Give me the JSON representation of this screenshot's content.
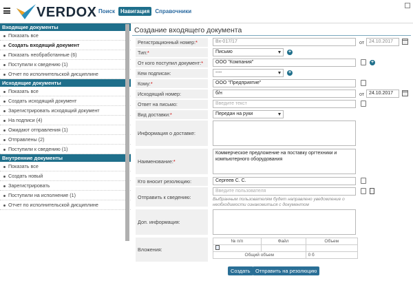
{
  "header": {
    "brand": "VERDOX",
    "nav": [
      "Поиск",
      "Навигация",
      "Справочники"
    ]
  },
  "sidebar": {
    "sections": [
      {
        "title": "Входящие документы",
        "items": [
          "Показать все",
          "Создать входящий документ",
          "Показать необработанные (6)",
          "Поступили к сведению (1)",
          "Отчет по исполнительской дисциплине"
        ]
      },
      {
        "title": "Исходящие документы",
        "items": [
          "Показать все",
          "Создать исходящий документ",
          "Зарегистрировать исходящий документ",
          "На подписи (4)",
          "Ожидают отправления (1)",
          "Отправлены (2)",
          "Поступили к сведению (1)"
        ]
      },
      {
        "title": "Внутренние документы",
        "items": [
          "Показать все",
          "Создать новый",
          "Зарегистрировать",
          "Поступили на исполнение (1)",
          "Отчет по исполнительской дисциплине"
        ]
      }
    ]
  },
  "form": {
    "title": "Создание входящего документа",
    "ot": "от",
    "fields": {
      "reg_number": {
        "label": "Регистрационный номер:",
        "value": "Вх-017/17",
        "date": "24.10.2017"
      },
      "type": {
        "label": "Тип:",
        "value": "Письмо"
      },
      "from": {
        "label": "От кого поступил документ:",
        "value": "ООО \"Компания\""
      },
      "signed_by": {
        "label": "Кем подписан:",
        "value": "----"
      },
      "to": {
        "label": "Кому:",
        "value": "ООО \"Предприятие\""
      },
      "out_number": {
        "label": "Исходящий номер:",
        "value": "б/н",
        "date": "24.10.2017"
      },
      "reply_to": {
        "label": "Ответ на письмо:",
        "placeholder": "Введите текст"
      },
      "delivery": {
        "label": "Вид доставки:",
        "value": "Передан на руки"
      },
      "delivery_info": {
        "label": "Информация о доставке:",
        "value": ""
      },
      "name": {
        "label": "Наименование:",
        "value": "Коммерческое предложение на поставку оргтехники и компьютерного оборудования"
      },
      "resolution_by": {
        "label": "Кто вносит резолюцию:",
        "value": "Сергеев С. С."
      },
      "send_info": {
        "label": "Отправить к сведению:",
        "placeholder": "Введите пользователя",
        "hint": "Выбранным пользователям будет направлено уведомление о необходимости ознакомиться с документом"
      },
      "extra": {
        "label": "Доп. информация:",
        "value": ""
      },
      "attachments": {
        "label": "Вложения:"
      }
    },
    "attachments_table": {
      "headers": [
        "№ п/п",
        "Файл",
        "Объем"
      ],
      "total_label": "Общий объем",
      "total_value": "0 б"
    },
    "buttons": {
      "create": "Создать",
      "send": "Отправить на резолюцию"
    }
  },
  "colors": {
    "accent": "#1f6f8b",
    "button": "#2a6f96",
    "required": "#cc0000"
  }
}
